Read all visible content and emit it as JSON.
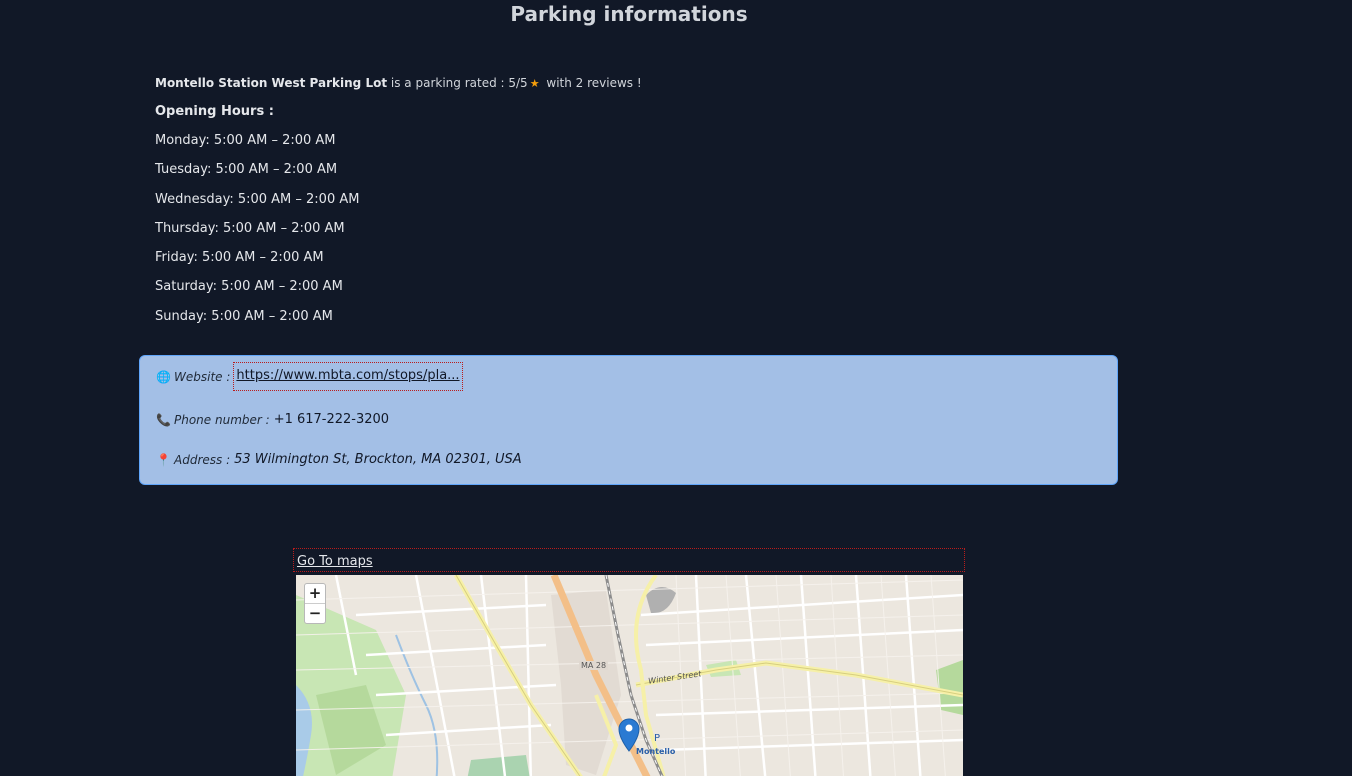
{
  "header": {
    "title": "Parking informations"
  },
  "summary": {
    "parking_name": "Montello Station West Parking Lot",
    "rated_text": "is a parking rated : 5/5",
    "rating": 5,
    "rating_max": 5,
    "reviews_text": "with 2 reviews !"
  },
  "hours": {
    "title": "Opening Hours :",
    "days": [
      "Monday: 5:00 AM – 2:00 AM",
      "Tuesday: 5:00 AM – 2:00 AM",
      "Wednesday: 5:00 AM – 2:00 AM",
      "Thursday: 5:00 AM – 2:00 AM",
      "Friday: 5:00 AM – 2:00 AM",
      "Saturday: 5:00 AM – 2:00 AM",
      "Sunday: 5:00 AM – 2:00 AM"
    ]
  },
  "contact": {
    "website_label": "Website :",
    "website_url": "https://www.mbta.com/stops/pla...",
    "phone_label": "Phone number :",
    "phone_value": "+1 617-222-3200",
    "address_label": "Address :",
    "address_value": "53 Wilmington St, Brockton, MA 02301, USA",
    "icons": [
      "globe-icon",
      "phone-icon",
      "pin-icon"
    ]
  },
  "map": {
    "link_label": "Go To maps",
    "zoom_in": "+",
    "zoom_out": "−",
    "labels": [
      "Winter Street",
      "Montello",
      "MA 28",
      "P"
    ]
  },
  "colors": {
    "background": "#111827",
    "contact_box": "#a3bfe6",
    "star": "#f59e0b",
    "marker": "#2a7ad2"
  }
}
